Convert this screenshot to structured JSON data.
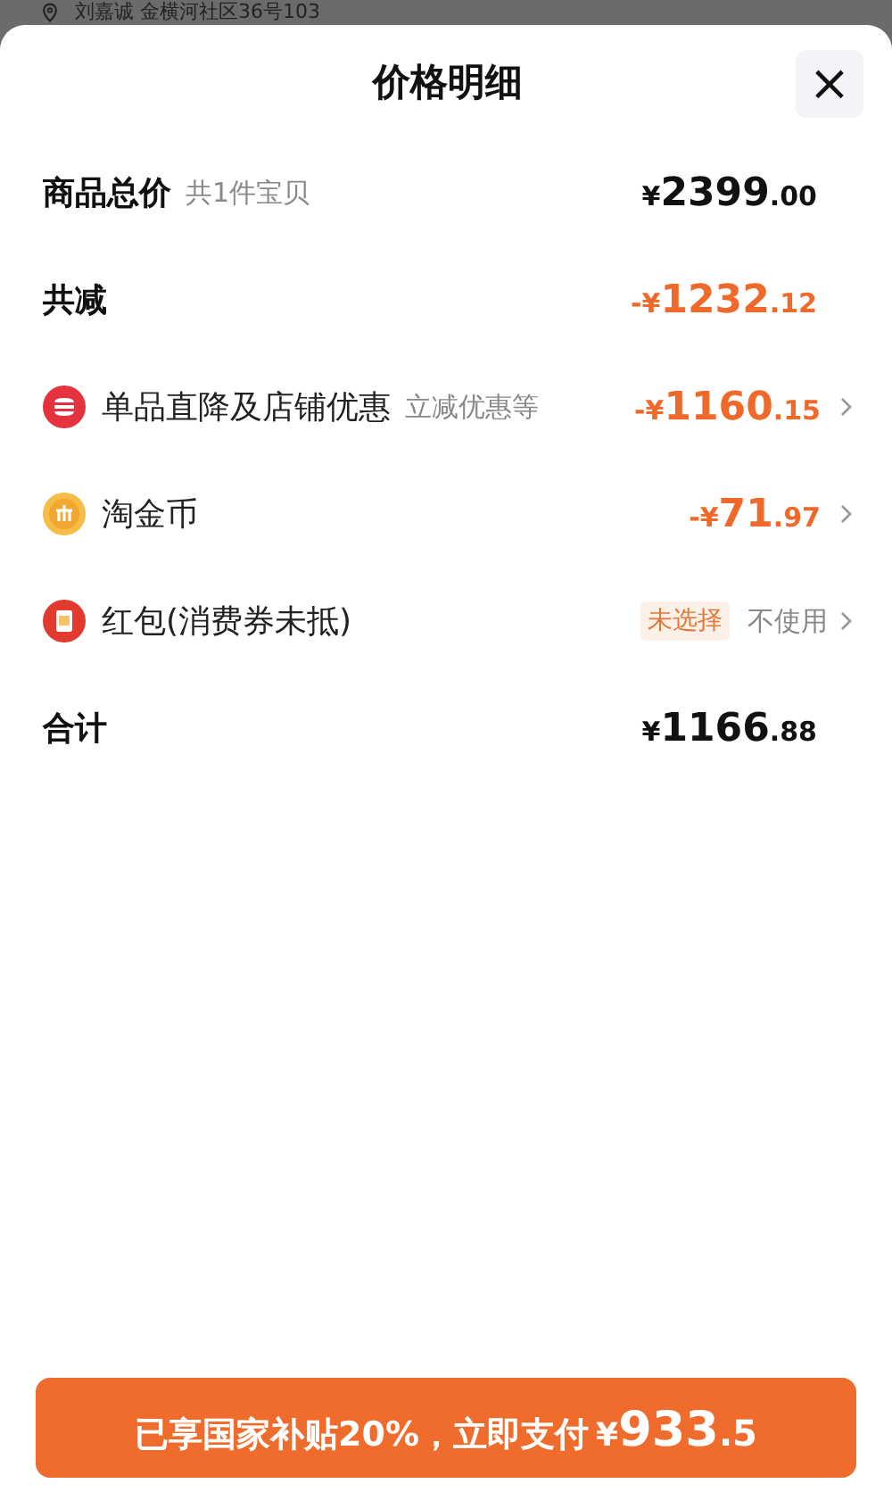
{
  "backdrop": {
    "address": "刘嘉诚 金横河社区36号103"
  },
  "sheet": {
    "title": "价格明细",
    "close_label": "×"
  },
  "rows": [
    {
      "kind": "plain",
      "label": "商品总价",
      "note": "共1件宝贝",
      "amount": {
        "prefix": "¥",
        "main": "2399",
        "decimal": ".00"
      },
      "highlight": false,
      "chevron": false
    },
    {
      "kind": "plain",
      "label": "共减",
      "amount": {
        "prefix": "-¥",
        "main": "1232",
        "decimal": ".12"
      },
      "highlight": true,
      "chevron": false
    },
    {
      "kind": "shop",
      "label": "单品直降及店铺优惠",
      "note": "立减优惠等",
      "amount": {
        "prefix": "-¥",
        "main": "1160",
        "decimal": ".15"
      },
      "highlight": true,
      "chevron": true
    },
    {
      "kind": "coin",
      "label": "淘金币",
      "amount": {
        "prefix": "-¥",
        "main": "71",
        "decimal": ".97"
      },
      "highlight": true,
      "chevron": true
    },
    {
      "kind": "packet",
      "label": "红包(消费券未抵)",
      "tag": "未选择",
      "value_text": "不使用",
      "chevron": true
    },
    {
      "kind": "plain",
      "label": "合计",
      "amount": {
        "prefix": "¥",
        "main": "1166",
        "decimal": ".88"
      },
      "highlight": false,
      "chevron": false
    }
  ],
  "pay_button": {
    "text": "已享国家补贴20%，立即支付",
    "amount": {
      "prefix": "¥",
      "main": "933",
      "decimal": ".5"
    }
  }
}
